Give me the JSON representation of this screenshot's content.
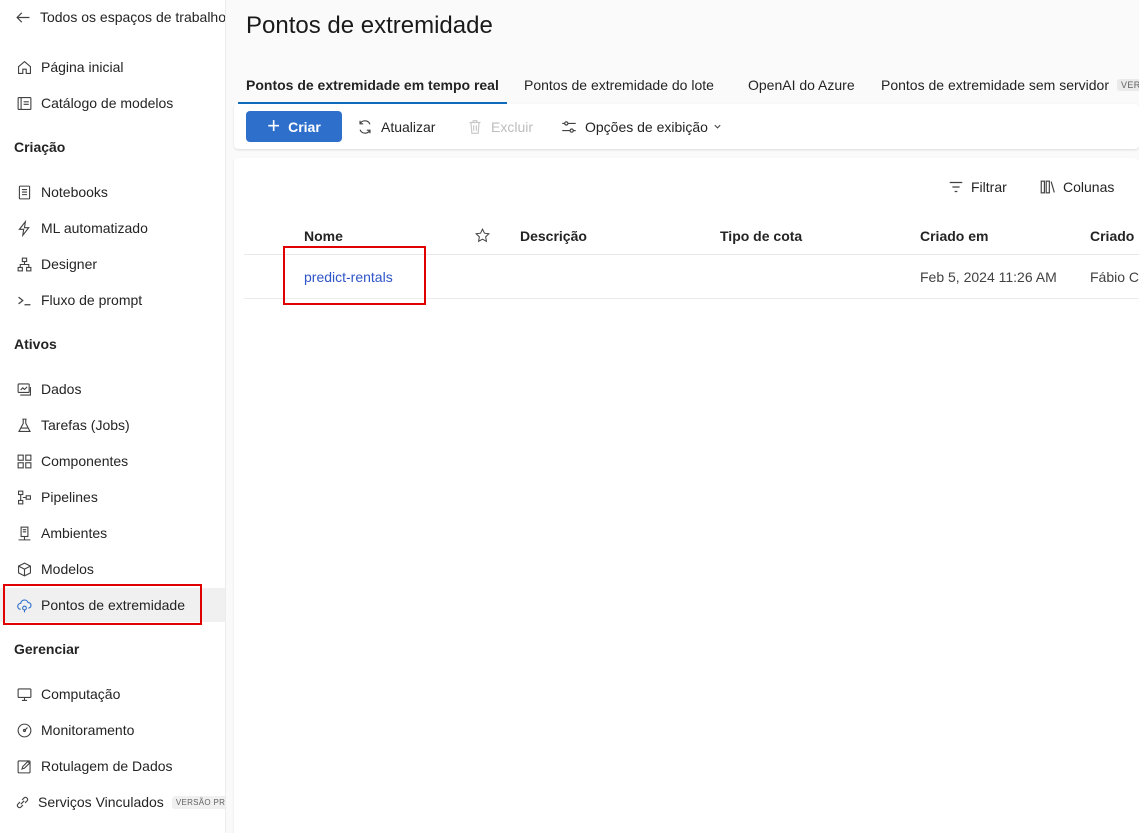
{
  "sidebar": {
    "back_label": "Todos os espaços de trabalho",
    "home": "Página inicial",
    "catalog": "Catálogo de modelos",
    "section_create": "Criação",
    "notebooks": "Notebooks",
    "automl": "ML automatizado",
    "designer": "Designer",
    "promptflow": "Fluxo de prompt",
    "section_assets": "Ativos",
    "data": "Dados",
    "jobs": "Tarefas (Jobs)",
    "components": "Componentes",
    "pipelines": "Pipelines",
    "environments": "Ambientes",
    "models": "Modelos",
    "endpoints": "Pontos de extremidade",
    "section_manage": "Gerenciar",
    "compute": "Computação",
    "monitoring": "Monitoramento",
    "labeling": "Rotulagem de Dados",
    "linked": "Serviços Vinculados",
    "linked_badge": "VERSÃO PRÉVIA"
  },
  "page": {
    "title": "Pontos de extremidade"
  },
  "tabs": {
    "realtime": "Pontos de extremidade em tempo real",
    "batch": "Pontos de extremidade do lote",
    "openai": "OpenAI do Azure",
    "serverless": "Pontos de extremidade sem servidor",
    "serverless_badge": "VERS"
  },
  "toolbar": {
    "create": "Criar",
    "refresh": "Atualizar",
    "delete": "Excluir",
    "view_options": "Opções de exibição"
  },
  "table": {
    "filter": "Filtrar",
    "columns": "Colunas",
    "headers": {
      "name": "Nome",
      "description": "Descrição",
      "quota_type": "Tipo de cota",
      "created_on": "Criado em",
      "created_by": "Criado p"
    },
    "rows": [
      {
        "name": "predict-rentals",
        "description": "",
        "quota_type": "",
        "created_on": "Feb 5, 2024 11:26 AM",
        "created_by": "Fábio Ca"
      }
    ]
  },
  "colors": {
    "accent": "#2e6fcb",
    "highlight": "#e00000",
    "link": "#2e55c8"
  }
}
